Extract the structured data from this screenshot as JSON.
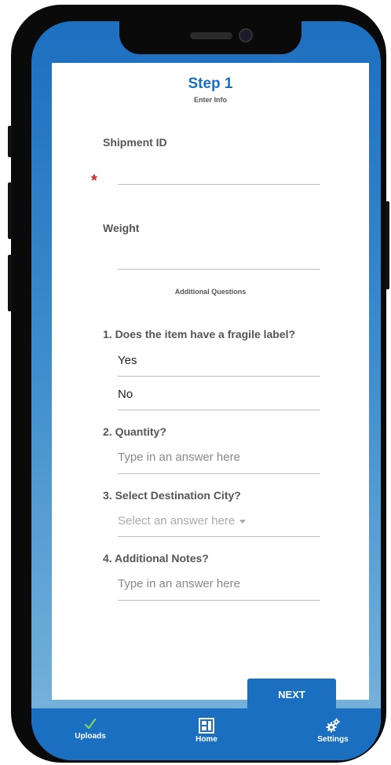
{
  "form": {
    "title": "Step 1",
    "subtitle": "Enter Info",
    "shipment_id_label": "Shipment ID",
    "required_marker": "*",
    "weight_label": "Weight",
    "section_title": "Additional Questions",
    "q1_label": "1. Does the item have a fragile label?",
    "q1_options": [
      "Yes",
      "No"
    ],
    "q2_label": "2. Quantity?",
    "q2_placeholder": "Type in an answer here",
    "q3_label": "3. Select Destination City?",
    "q3_placeholder": "Select an answer here",
    "q4_label": "4. Additional Notes?",
    "q4_placeholder": "Type in an answer here",
    "next_label": "NEXT"
  },
  "tabbar": {
    "items": [
      {
        "label": "Uploads",
        "icon": "check-icon"
      },
      {
        "label": "Home",
        "icon": "home-grid-icon"
      },
      {
        "label": "Settings",
        "icon": "gears-icon"
      }
    ]
  },
  "colors": {
    "accent": "#1a6fc1",
    "required": "#cc2222",
    "check": "#7ed957"
  }
}
